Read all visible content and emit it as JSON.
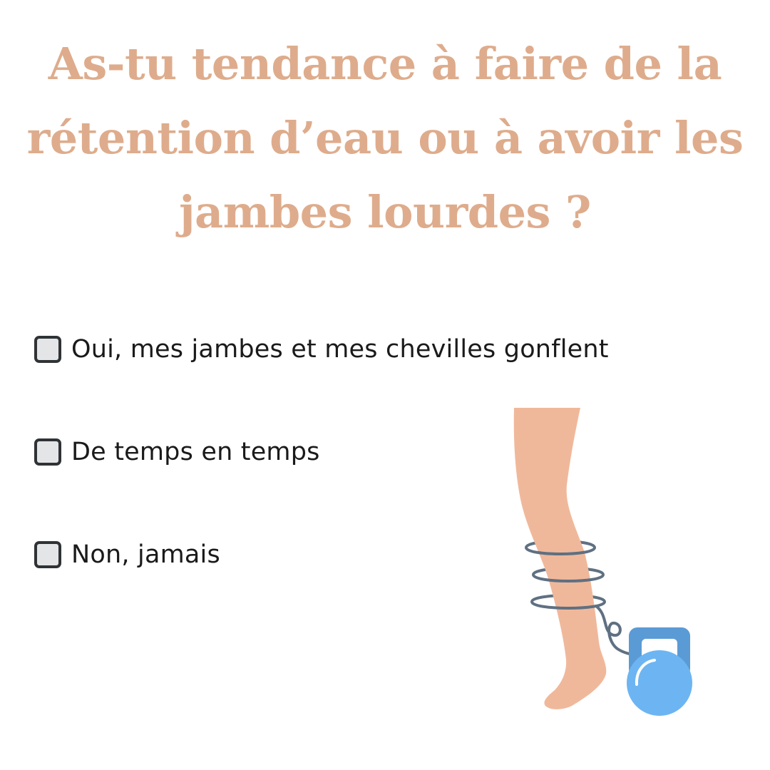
{
  "question": {
    "line1": "As-tu tendance à faire de la",
    "line2": "rétention d’eau ou à avoir les",
    "line3": "jambes lourdes ?"
  },
  "options": [
    {
      "label": "Oui, mes jambes et mes chevilles gonflent",
      "checked": false
    },
    {
      "label": "De temps en temps",
      "checked": false
    },
    {
      "label": "Non, jamais",
      "checked": false
    }
  ],
  "illustration": {
    "icon": "leg-with-kettlebell-icon"
  },
  "colors": {
    "title": "#deac8c",
    "text": "#1a1a1a",
    "checkbox_border": "#2f3336",
    "checkbox_fill": "#e4e5e7",
    "skin": "#f0b89b",
    "rings": "#5f7081",
    "kettlebell_top": "#5b9bd5",
    "kettlebell_body": "#6cb5f2"
  }
}
